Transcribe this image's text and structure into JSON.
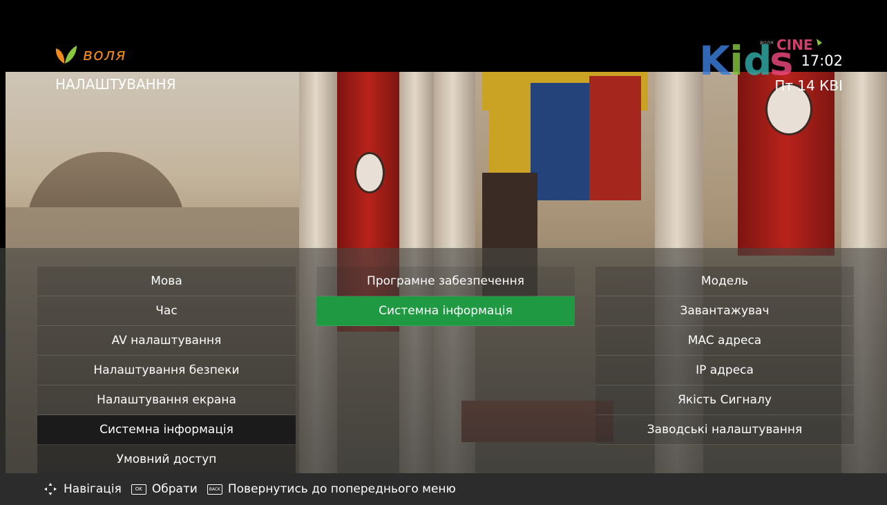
{
  "brand": {
    "logo_text": "воля",
    "color": "#f28a1a"
  },
  "header": {
    "title": "НАЛАШТУВАННЯ",
    "time": "17:02",
    "date": "Пт 14 КВІ",
    "channel_logo": {
      "text_main": "Kids",
      "text_top": "CINE",
      "text_small": "воля"
    }
  },
  "menu": {
    "main": [
      {
        "label": "Мова"
      },
      {
        "label": "Час"
      },
      {
        "label": "AV налаштування"
      },
      {
        "label": "Налаштування безпеки"
      },
      {
        "label": "Налаштування екрана"
      },
      {
        "label": "Системна інформація",
        "state": "selected"
      },
      {
        "label": "Умовний доступ"
      }
    ],
    "sub": [
      {
        "label": "Програмне забезпечення"
      },
      {
        "label": "Системна інформація",
        "state": "focused"
      }
    ],
    "details": [
      {
        "label": "Модель"
      },
      {
        "label": "Завантажувач"
      },
      {
        "label": "MAC адреса"
      },
      {
        "label": "IP адреса"
      },
      {
        "label": "Якість Сигналу"
      },
      {
        "label": "Заводські налаштування"
      }
    ]
  },
  "footer": {
    "nav_label": "Навігація",
    "ok_key": "OK",
    "ok_label": "Обрати",
    "back_key": "BACK",
    "back_label": "Повернутись до попереднього меню"
  },
  "colors": {
    "highlight": "#1f9a43",
    "selected_parent": "#1b1b1b",
    "footer_bg": "#2c2c2c"
  }
}
